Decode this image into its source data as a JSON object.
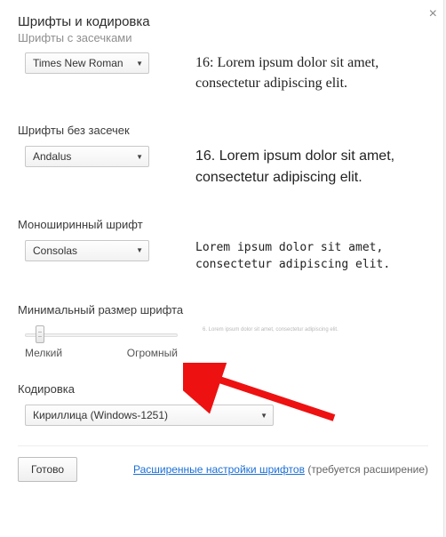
{
  "window": {
    "title": "Шрифты и кодировка"
  },
  "sections": {
    "serif": {
      "label": "Шрифты с засечками",
      "select": "Times New Roman",
      "preview": "16: Lorem ipsum dolor sit amet, consectetur adipiscing elit."
    },
    "sans": {
      "label": "Шрифты без засечек",
      "select": "Andalus",
      "preview": "16. Lorem ipsum dolor sit amet, consectetur adipiscing elit."
    },
    "mono": {
      "label": "Моноширинный шрифт",
      "select": "Consolas",
      "preview": "Lorem ipsum dolor sit amet, consectetur adipiscing elit."
    },
    "minsize": {
      "label": "Минимальный размер шрифта",
      "slider_min_label": "Мелкий",
      "slider_max_label": "Огромный",
      "preview": "6. Lorem ipsum dolor sit amet, consectetur adipiscing elit."
    },
    "encoding": {
      "label": "Кодировка",
      "select": "Кириллица (Windows-1251)"
    }
  },
  "footer": {
    "done": "Готово",
    "link": "Расширенные настройки шрифтов",
    "note": " (требуется расширение)"
  }
}
